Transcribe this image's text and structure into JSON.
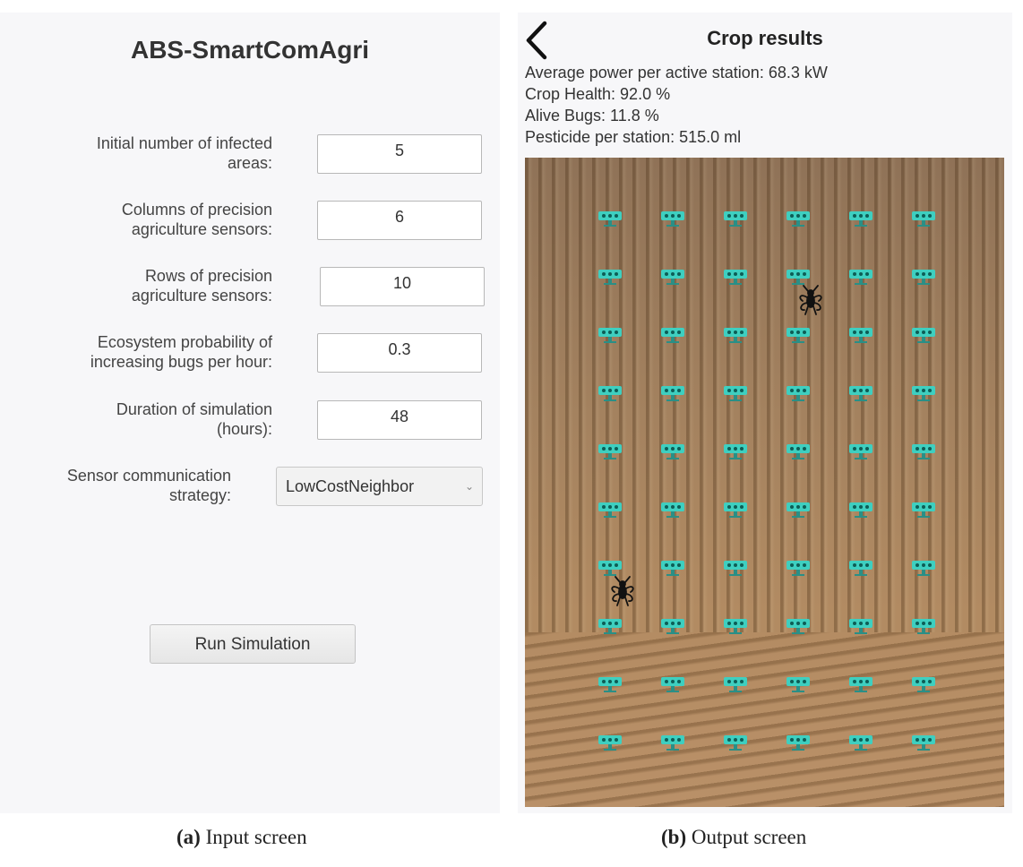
{
  "input_screen": {
    "app_title": "ABS-SmartComAgri",
    "fields": [
      {
        "label_lines": [
          "Initial number of infected",
          "areas:"
        ],
        "value": "5"
      },
      {
        "label_lines": [
          "Columns of precision",
          "agriculture sensors:"
        ],
        "value": "6"
      },
      {
        "label_lines": [
          "Rows of precision",
          "agriculture sensors:"
        ],
        "value": "10"
      },
      {
        "label_lines": [
          "Ecosystem probability of",
          "increasing bugs per hour:"
        ],
        "value": "0.3"
      },
      {
        "label_lines": [
          "Duration of simulation",
          "(hours):"
        ],
        "value": "48"
      }
    ],
    "strategy": {
      "label_lines": [
        "Sensor communication",
        "strategy:"
      ],
      "value": "LowCostNeighbor"
    },
    "run_button": "Run Simulation"
  },
  "output_screen": {
    "title": "Crop results",
    "stats": [
      "Average power per active station: 68.3 kW",
      "Crop Health: 92.0 %",
      "Alive Bugs: 11.8 %",
      "Pesticide per station: 515.0 ml"
    ],
    "sensor_grid": {
      "columns": 6,
      "rows": 10
    },
    "bugs": [
      {
        "row": 2,
        "col": 4
      },
      {
        "row": 7,
        "col": 1
      }
    ],
    "colors": {
      "sensor": "#3ecfc0",
      "bug": "#111111"
    }
  },
  "captions": [
    {
      "letter": "(a)",
      "text": " Input screen"
    },
    {
      "letter": "(b)",
      "text": " Output screen"
    }
  ]
}
